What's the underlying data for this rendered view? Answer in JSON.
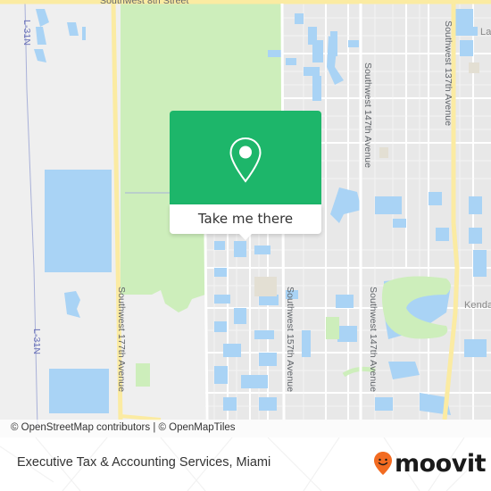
{
  "map": {
    "road_labels": {
      "sw_8th_street": "Southwest 8th Street",
      "sw_177th_avenue": "Southwest 177th Avenue",
      "sw_157th_avenue": "Southwest 157th Avenue",
      "sw_147th_avenue_north": "Southwest 147th Avenue",
      "sw_147th_avenue_south": "Southwest 147th Avenue",
      "sw_137th_avenue": "Southwest 137th Avenue",
      "canal_l31n_top": "L-31N",
      "canal_l31n_bottom": "L-31N",
      "place_kendall_partial": "Kenda",
      "place_top_right_partial": "La"
    },
    "colors": {
      "land": "#efefef",
      "park": "#cdeebb",
      "water": "#a9d3f5",
      "major_road": "#fbeba2",
      "minor_road": "#ffffff"
    },
    "attribution": "© OpenStreetMap contributors | © OpenMapTiles"
  },
  "popup": {
    "icon": "map-pin-icon",
    "button_label": "Take me there",
    "color": "#1db66a"
  },
  "footer": {
    "title": "Executive Tax & Accounting Services, Miami",
    "logo_text": "moovit",
    "logo_icon": "moovit-smile-pin-icon",
    "logo_color": "#f26b21"
  }
}
